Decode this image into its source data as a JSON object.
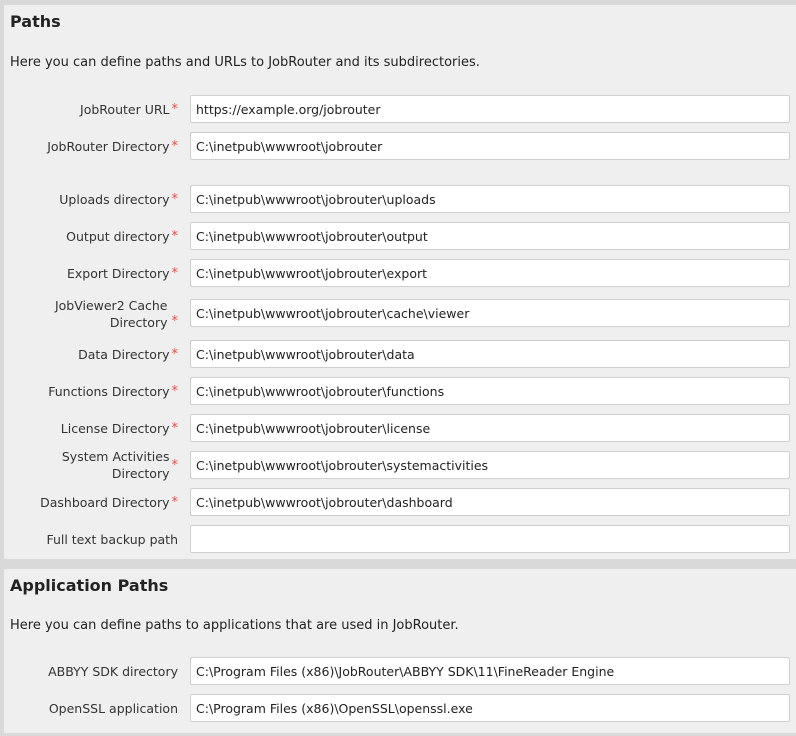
{
  "paths": {
    "title": "Paths",
    "description": "Here you can define paths and URLs to JobRouter and its subdirectories.",
    "required_marker": "*",
    "fields": [
      {
        "label": "JobRouter URL",
        "value": "https://example.org/jobrouter"
      },
      {
        "label": "JobRouter Directory",
        "value": "C:\\inetpub\\wwwroot\\jobrouter"
      },
      {
        "label": "Uploads directory",
        "value": "C:\\inetpub\\wwwroot\\jobrouter\\uploads"
      },
      {
        "label": "Output directory",
        "value": "C:\\inetpub\\wwwroot\\jobrouter\\output"
      },
      {
        "label": "Export Directory",
        "value": "C:\\inetpub\\wwwroot\\jobrouter\\export"
      },
      {
        "label": "JobViewer2 Cache Directory",
        "value": "C:\\inetpub\\wwwroot\\jobrouter\\cache\\viewer"
      },
      {
        "label": "Data Directory",
        "value": "C:\\inetpub\\wwwroot\\jobrouter\\data"
      },
      {
        "label": "Functions Directory",
        "value": "C:\\inetpub\\wwwroot\\jobrouter\\functions"
      },
      {
        "label": "License Directory",
        "value": "C:\\inetpub\\wwwroot\\jobrouter\\license"
      },
      {
        "label": "System Activities Directory",
        "value": "C:\\inetpub\\wwwroot\\jobrouter\\systemactivities"
      },
      {
        "label": "Dashboard Directory",
        "value": "C:\\inetpub\\wwwroot\\jobrouter\\dashboard"
      },
      {
        "label": "Full text backup path",
        "value": ""
      }
    ]
  },
  "application_paths": {
    "title": "Application Paths",
    "description": "Here you can define paths to applications that are used in JobRouter.",
    "fields": [
      {
        "label": "ABBYY SDK directory",
        "value": "C:\\Program Files (x86)\\JobRouter\\ABBYY SDK\\11\\FineReader Engine"
      },
      {
        "label": "OpenSSL application",
        "value": "C:\\Program Files (x86)\\OpenSSL\\openssl.exe"
      }
    ]
  },
  "colors": {
    "required_marker": "#d9534f",
    "panel_background": "#efefef",
    "page_background": "#d9d9d9"
  }
}
